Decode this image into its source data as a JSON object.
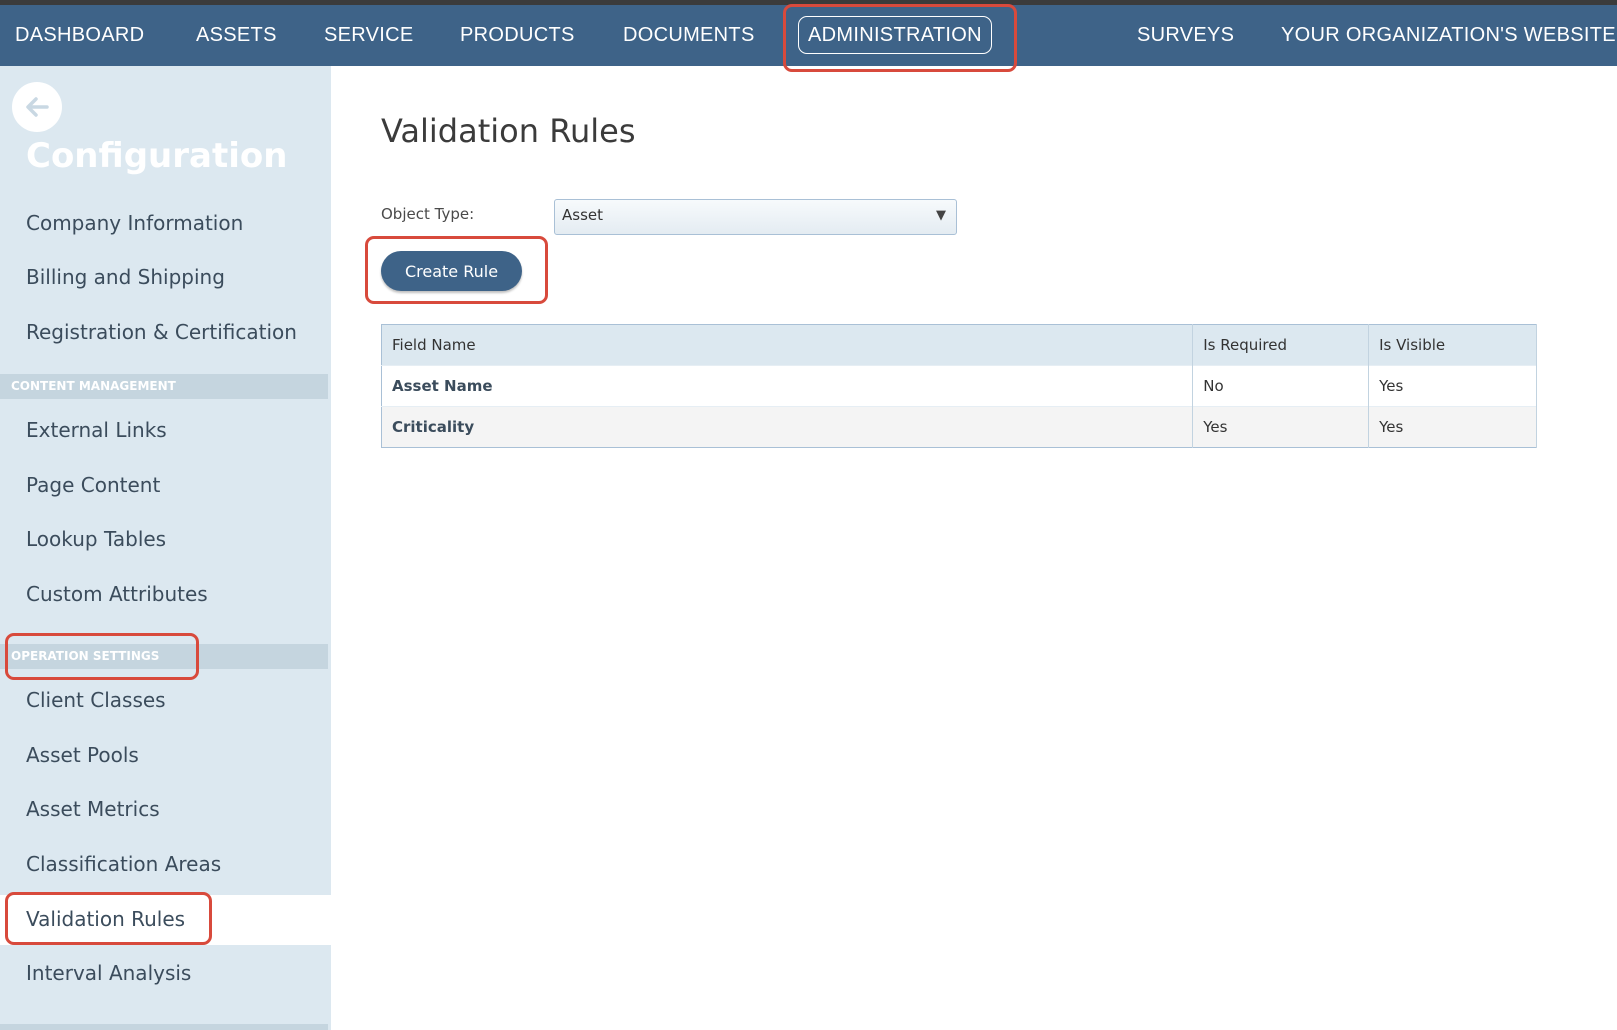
{
  "nav": {
    "items": [
      {
        "label": "DASHBOARD"
      },
      {
        "label": "ASSETS"
      },
      {
        "label": "SERVICE"
      },
      {
        "label": "PRODUCTS"
      },
      {
        "label": "DOCUMENTS"
      },
      {
        "label": "ADMINISTRATION",
        "active": true
      },
      {
        "label": "SURVEYS"
      },
      {
        "label": "YOUR ORGANIZATION'S WEBSITE"
      }
    ]
  },
  "sidebar": {
    "title": "Configuration",
    "items": [
      {
        "label": "Company Information"
      },
      {
        "label": "Billing and Shipping"
      },
      {
        "label": "Registration & Certification"
      }
    ],
    "sections": [
      {
        "header": "CONTENT MANAGEMENT",
        "items": [
          {
            "label": "External Links"
          },
          {
            "label": "Page Content"
          },
          {
            "label": "Lookup Tables"
          },
          {
            "label": "Custom Attributes"
          }
        ]
      },
      {
        "header": "OPERATION SETTINGS",
        "items": [
          {
            "label": "Client Classes"
          },
          {
            "label": "Asset Pools"
          },
          {
            "label": "Asset Metrics"
          },
          {
            "label": "Classification Areas"
          },
          {
            "label": "Validation Rules",
            "selected": true
          },
          {
            "label": "Interval Analysis"
          }
        ]
      }
    ]
  },
  "main": {
    "title": "Validation Rules",
    "object_type_label": "Object Type:",
    "object_type_value": "Asset",
    "create_button": "Create Rule",
    "table": {
      "headers": [
        "Field Name",
        "Is Required",
        "Is Visible"
      ],
      "rows": [
        [
          "Asset Name",
          "No",
          "Yes"
        ],
        [
          "Criticality",
          "Yes",
          "Yes"
        ]
      ]
    }
  },
  "colors": {
    "nav_bg": "#3e6388",
    "sidebar_bg": "#dce8f0",
    "highlight": "#d84a3c"
  }
}
